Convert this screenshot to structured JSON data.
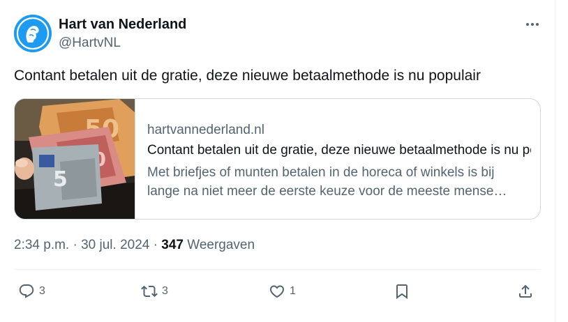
{
  "author": {
    "name": "Hart van Nederland",
    "handle": "@HartvNL",
    "avatar_icon": "hart-logo-icon"
  },
  "tweet": {
    "text": "Contant betalen uit de gratie, deze nieuwe betaalmethode is nu populair"
  },
  "card": {
    "domain": "hartvannederland.nl",
    "title": "Contant betalen uit de gratie, deze nieuwe betaalmethode is nu populair",
    "description_line1": "Met briefjes of munten betalen in de horeca of winkels is bij",
    "description_line2": "lange na niet meer de eerste keuze voor de meeste mense…",
    "image": "euro-banknotes-in-wallet"
  },
  "meta": {
    "time": "2:34 p.m.",
    "separator": "·",
    "date": "30 jul. 2024",
    "views_count": "347",
    "views_label": "Weergaven"
  },
  "actions": {
    "replies": "3",
    "reposts": "3",
    "likes": "1"
  },
  "colors": {
    "text": "#0f1419",
    "secondary": "#536471",
    "border": "#cfd9de",
    "avatar_bg": "#1d9bf0"
  }
}
